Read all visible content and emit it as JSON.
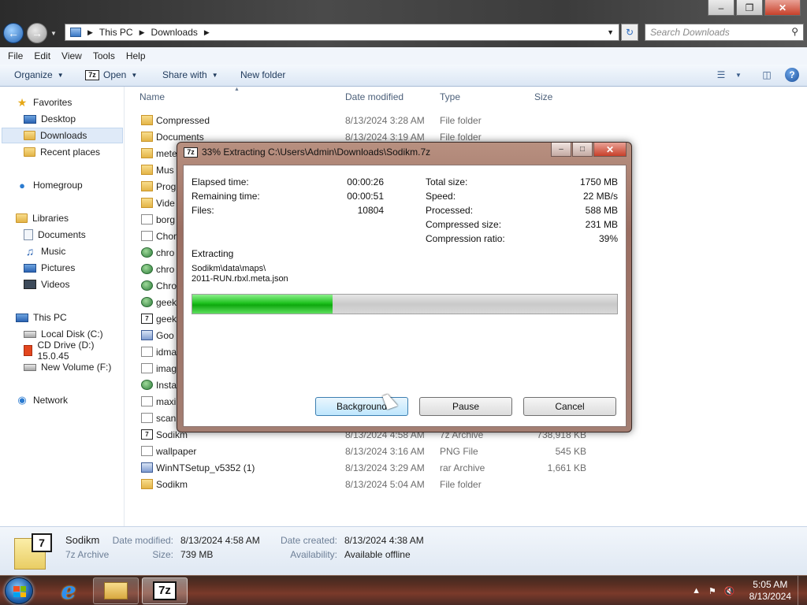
{
  "window": {
    "caption_buttons": [
      "minimize",
      "maximize",
      "close"
    ]
  },
  "address_bar": {
    "crumbs": [
      "This PC",
      "Downloads"
    ]
  },
  "search": {
    "placeholder": "Search Downloads"
  },
  "menu": [
    "File",
    "Edit",
    "View",
    "Tools",
    "Help"
  ],
  "command_bar": {
    "organize": "Organize",
    "open": "Open",
    "share_with": "Share with",
    "new_folder": "New folder"
  },
  "nav_pane": {
    "favorites": "Favorites",
    "desktop": "Desktop",
    "downloads": "Downloads",
    "recent": "Recent places",
    "homegroup": "Homegroup",
    "libraries": "Libraries",
    "documents": "Documents",
    "music": "Music",
    "pictures": "Pictures",
    "videos": "Videos",
    "thispc": "This PC",
    "localdisk": "Local Disk (C:)",
    "cddrive": "CD Drive (D:) 15.0.45",
    "newvolume": "New Volume (F:)",
    "network": "Network"
  },
  "columns": {
    "name": "Name",
    "date": "Date modified",
    "type": "Type",
    "size": "Size"
  },
  "files": [
    {
      "name": "Compressed",
      "date": "8/13/2024 3:28 AM",
      "type": "File folder",
      "size": "",
      "icon": "folder"
    },
    {
      "name": "Documents",
      "date": "8/13/2024 3:19 AM",
      "type": "File folder",
      "size": "",
      "icon": "folder"
    },
    {
      "name": "mete",
      "date": "",
      "type": "",
      "size": "",
      "icon": "folder"
    },
    {
      "name": "Mus",
      "date": "",
      "type": "",
      "size": "",
      "icon": "folder"
    },
    {
      "name": "Prog",
      "date": "",
      "type": "",
      "size": "",
      "icon": "folder"
    },
    {
      "name": "Vide",
      "date": "",
      "type": "",
      "size": "",
      "icon": "folder"
    },
    {
      "name": "borg",
      "date": "",
      "type": "",
      "size": "",
      "icon": "file"
    },
    {
      "name": "Chor",
      "date": "",
      "type": "",
      "size": "",
      "icon": "file"
    },
    {
      "name": "chro",
      "date": "",
      "type": "",
      "size": "",
      "icon": "round"
    },
    {
      "name": "chro",
      "date": "",
      "type": "",
      "size": "",
      "icon": "round"
    },
    {
      "name": "Chro",
      "date": "",
      "type": "",
      "size": "",
      "icon": "round"
    },
    {
      "name": "geek",
      "date": "",
      "type": "",
      "size": "",
      "icon": "round"
    },
    {
      "name": "geek",
      "date": "",
      "type": "",
      "size": "",
      "icon": "sz"
    },
    {
      "name": "Goo",
      "date": "",
      "type": "",
      "size": "",
      "icon": "rar"
    },
    {
      "name": "idma",
      "date": "",
      "type": "",
      "size": "",
      "icon": "file"
    },
    {
      "name": "imag",
      "date": "",
      "type": "",
      "size": "",
      "icon": "file"
    },
    {
      "name": "Insta",
      "date": "",
      "type": "",
      "size": "",
      "icon": "round"
    },
    {
      "name": "maxi",
      "date": "",
      "type": "",
      "size": "",
      "icon": "file"
    },
    {
      "name": "scan",
      "date": "",
      "type": "",
      "size": "",
      "icon": "file"
    },
    {
      "name": "Sodikm",
      "date": "8/13/2024 4:58 AM",
      "type": "7z Archive",
      "size": "738,918 KB",
      "icon": "sz"
    },
    {
      "name": "wallpaper",
      "date": "8/13/2024 3:16 AM",
      "type": "PNG File",
      "size": "545 KB",
      "icon": "file"
    },
    {
      "name": "WinNTSetup_v5352 (1)",
      "date": "8/13/2024 3:29 AM",
      "type": "rar Archive",
      "size": "1,661 KB",
      "icon": "rar"
    },
    {
      "name": "Sodikm",
      "date": "8/13/2024 5:04 AM",
      "type": "File folder",
      "size": "",
      "icon": "folder"
    }
  ],
  "details_pane": {
    "icon_badge": "7",
    "name": "Sodikm",
    "kind": "7z Archive",
    "date_modified_label": "Date modified:",
    "date_modified": "8/13/2024 4:58 AM",
    "size_label": "Size:",
    "size": "739 MB",
    "date_created_label": "Date created:",
    "date_created": "8/13/2024 4:38 AM",
    "availability_label": "Availability:",
    "availability": "Available offline"
  },
  "dialog": {
    "title": "33% Extracting C:\\Users\\Admin\\Downloads\\Sodikm.7z",
    "progress_fraction": 0.33,
    "elapsed_label": "Elapsed time:",
    "elapsed": "00:00:26",
    "remaining_label": "Remaining time:",
    "remaining": "00:00:51",
    "files_label": "Files:",
    "files": "10804",
    "total_label": "Total size:",
    "total": "1750 MB",
    "speed_label": "Speed:",
    "speed": "22 MB/s",
    "processed_label": "Processed:",
    "processed": "588 MB",
    "compressed_label": "Compressed size:",
    "compressed": "231 MB",
    "ratio_label": "Compression ratio:",
    "ratio": "39%",
    "extracting_label": "Extracting",
    "path_line1": "Sodikm\\data\\maps\\",
    "path_line2": "2011-RUN.rbxl.meta.json",
    "btn_background": "Background",
    "btn_pause": "Pause",
    "btn_cancel": "Cancel"
  },
  "taskbar": {
    "time": "5:05 AM",
    "date": "8/13/2024",
    "seven_zip_label": "7z"
  },
  "icons": {
    "sz7_text": "7z"
  },
  "colors": {
    "progress_green": "#1ec21e",
    "taskbar": "#5a2e22"
  }
}
